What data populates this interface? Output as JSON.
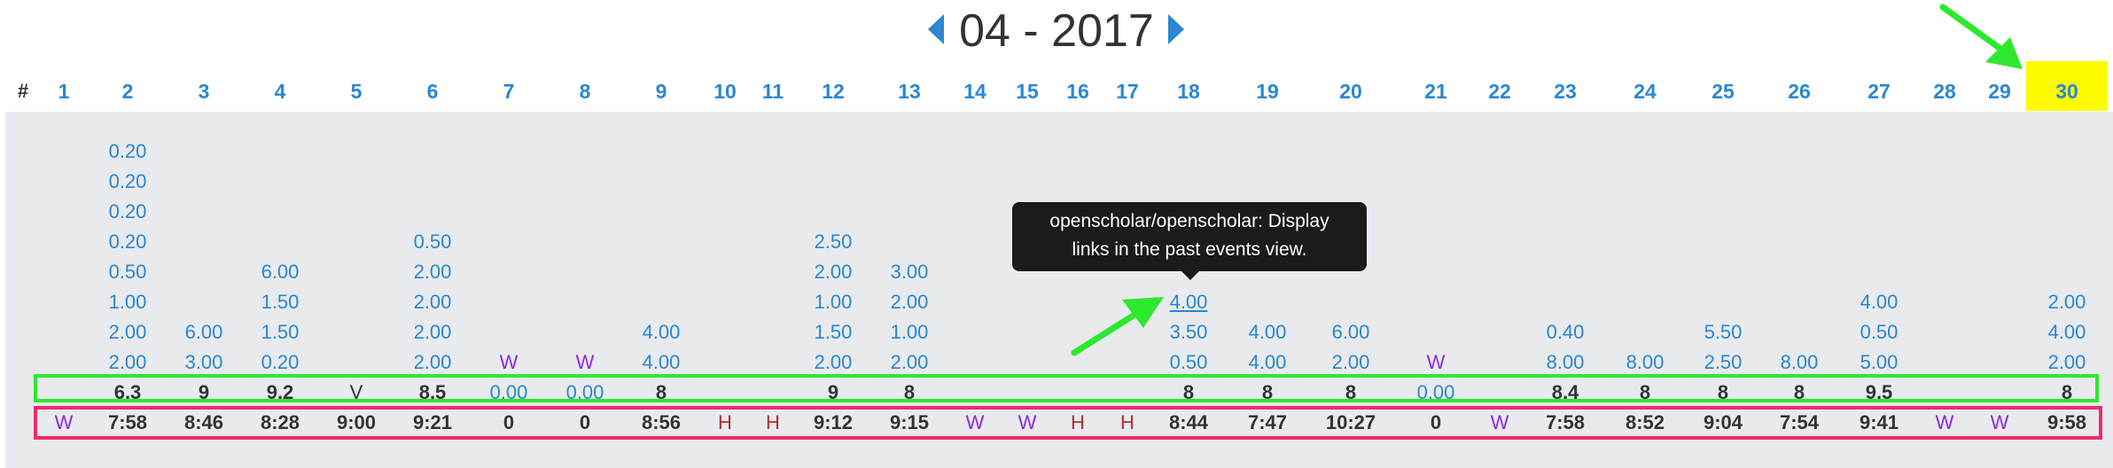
{
  "nav": {
    "title": "04 - 2017",
    "prev_label": "previous-month",
    "next_label": "next-month"
  },
  "header": {
    "hash": "#",
    "days": [
      "1",
      "2",
      "3",
      "4",
      "5",
      "6",
      "7",
      "8",
      "9",
      "10",
      "11",
      "12",
      "13",
      "14",
      "15",
      "16",
      "17",
      "18",
      "19",
      "20",
      "21",
      "22",
      "23",
      "24",
      "25",
      "26",
      "27",
      "28",
      "29",
      "30"
    ],
    "highlighted_day": "30",
    "highlight_color": "#fffb00"
  },
  "entries": {
    "2": [
      "0.20",
      "0.20",
      "0.20",
      "0.20",
      "0.50",
      "1.00",
      "2.00",
      "2.00"
    ],
    "3": [
      "6.00",
      "3.00"
    ],
    "4": [
      "6.00",
      "1.50",
      "1.50",
      "0.20"
    ],
    "6": [
      "0.50",
      "2.00",
      "2.00",
      "2.00",
      "2.00"
    ],
    "9": [
      "4.00",
      "4.00"
    ],
    "12": [
      "2.50",
      "2.00",
      "1.00",
      "1.50",
      "2.00"
    ],
    "13": [
      "3.00",
      "2.00",
      "1.00",
      "2.00"
    ],
    "18": [
      "4.00",
      "3.50",
      "0.50"
    ],
    "19": [
      "4.00",
      "4.00"
    ],
    "20": [
      "6.00",
      "2.00"
    ],
    "23": [
      "0.40",
      "8.00"
    ],
    "24": [
      "8.00"
    ],
    "25": [
      "5.50",
      "2.50"
    ],
    "26": [
      "8.00"
    ],
    "27": [
      "4.00",
      "0.50",
      "5.00"
    ],
    "30": [
      "2.00",
      "4.00",
      "2.00"
    ]
  },
  "w_marks_entry_row": [
    "7",
    "8",
    "21"
  ],
  "totals": {
    "2": "6.3",
    "3": "9",
    "4": "9.2",
    "5": "V",
    "6": "8.5",
    "7": "0.00",
    "8": "0.00",
    "9": "8",
    "12": "9",
    "13": "8",
    "18": "8",
    "19": "8",
    "20": "8",
    "21": "0.00",
    "23": "8.4",
    "24": "8",
    "25": "8",
    "26": "8",
    "27": "9.5",
    "30": "8"
  },
  "times": {
    "1": "W",
    "2": "7:58",
    "3": "8:46",
    "4": "8:28",
    "5": "9:00",
    "6": "9:21",
    "7": "0",
    "8": "0",
    "9": "8:56",
    "10": "H",
    "11": "H",
    "12": "9:12",
    "13": "9:15",
    "14": "W",
    "15": "W",
    "16": "H",
    "17": "H",
    "18": "8:44",
    "19": "7:47",
    "20": "10:27",
    "21": "0",
    "22": "W",
    "23": "7:58",
    "24": "8:52",
    "25": "9:04",
    "26": "7:54",
    "27": "9:41",
    "28": "W",
    "29": "W",
    "30": "9:58"
  },
  "tooltip": {
    "line1": "openscholar/openscholar: Display",
    "line2": "links in the past events view."
  },
  "colors": {
    "link_blue": "#2a87d0",
    "purple": "#8a2be2",
    "holiday_red": "#b03030",
    "green_outline": "#2ee82e",
    "pink_outline": "#ee2a6b",
    "annotation_arrow": "#2ee82e"
  }
}
